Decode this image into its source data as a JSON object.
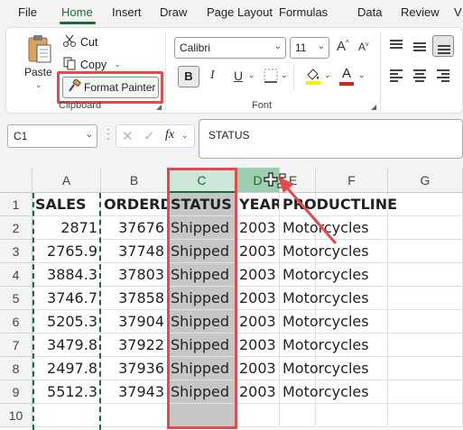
{
  "menu": {
    "tabs": [
      "File",
      "Home",
      "Insert",
      "Draw",
      "Page Layout",
      "Formulas",
      "Data",
      "Review",
      "V"
    ],
    "active": "Home"
  },
  "ribbon": {
    "clipboard": {
      "paste_label": "Paste",
      "cut_label": "Cut",
      "copy_label": "Copy",
      "format_painter_label": "Format Painter",
      "group_label": "Clipboard"
    },
    "font": {
      "font_name": "Calibri",
      "font_size": "11",
      "bold_label": "B",
      "italic_label": "I",
      "underline_label": "U",
      "group_label": "Font",
      "grow_label": "A",
      "shrink_label": "A"
    }
  },
  "formula_bar": {
    "name_box": "C1",
    "fx_label": "fx",
    "content": "STATUS"
  },
  "sheet": {
    "columns": [
      "A",
      "B",
      "C",
      "D",
      "E",
      "F",
      "G"
    ],
    "selected_column": "C",
    "rows": [
      "1",
      "2",
      "3",
      "4",
      "5",
      "6",
      "7",
      "8",
      "9",
      "10"
    ],
    "header": [
      "SALES",
      "ORDERD",
      "STATUS",
      "YEAR_",
      "PRODUCTLINE"
    ],
    "data": [
      [
        "2871",
        "37676",
        "Shipped",
        "2003",
        "Motorcycles"
      ],
      [
        "2765.9",
        "37748",
        "Shipped",
        "2003",
        "Motorcycles"
      ],
      [
        "3884.3",
        "37803",
        "Shipped",
        "2003",
        "Motorcycles"
      ],
      [
        "3746.7",
        "37858",
        "Shipped",
        "2003",
        "Motorcycles"
      ],
      [
        "5205.3",
        "37904",
        "Shipped",
        "2003",
        "Motorcycles"
      ],
      [
        "3479.8",
        "37922",
        "Shipped",
        "2003",
        "Motorcycles"
      ],
      [
        "2497.8",
        "37936",
        "Shipped",
        "2003",
        "Motorcycles"
      ],
      [
        "5512.3",
        "37943",
        "Shipped",
        "2003",
        "Motorcycles"
      ]
    ]
  },
  "colors": {
    "accent": "#1a6b3a",
    "highlight": "#e24b4b",
    "selected_header": "#cde7d8",
    "selected_cells": "#c6c6c6"
  }
}
